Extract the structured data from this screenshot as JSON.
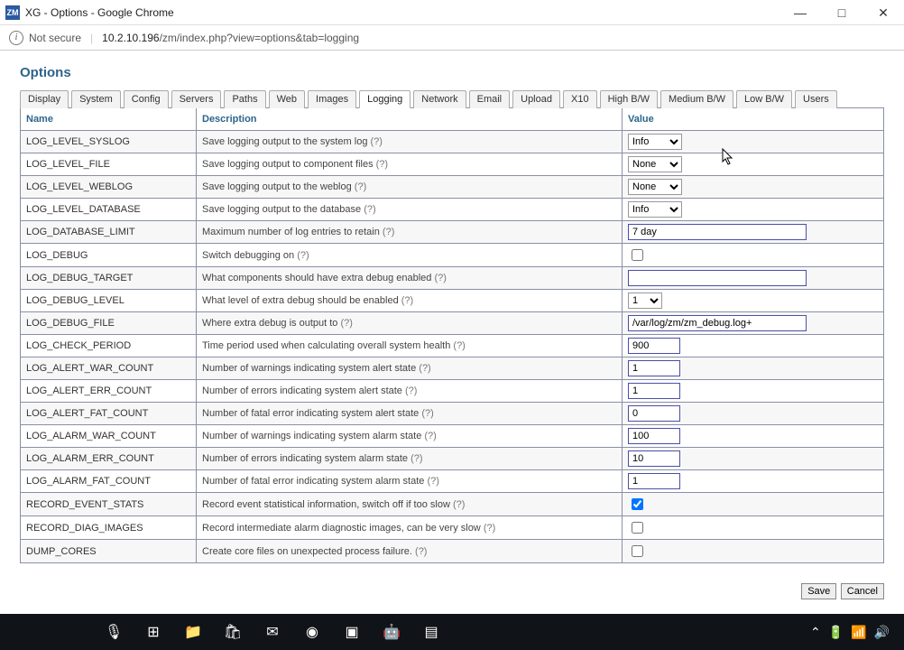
{
  "window": {
    "app_icon": "ZM",
    "title": "XG - Options - Google Chrome"
  },
  "address": {
    "insecure_label": "Not secure",
    "host": "10.2.10.196",
    "path": "/zm/index.php?view=options&tab=logging"
  },
  "page_title": "Options",
  "tabs": [
    {
      "label": "Display"
    },
    {
      "label": "System"
    },
    {
      "label": "Config"
    },
    {
      "label": "Servers"
    },
    {
      "label": "Paths"
    },
    {
      "label": "Web"
    },
    {
      "label": "Images"
    },
    {
      "label": "Logging",
      "active": true
    },
    {
      "label": "Network"
    },
    {
      "label": "Email"
    },
    {
      "label": "Upload"
    },
    {
      "label": "X10"
    },
    {
      "label": "High B/W"
    },
    {
      "label": "Medium B/W"
    },
    {
      "label": "Low B/W"
    },
    {
      "label": "Users"
    }
  ],
  "headers": {
    "name": "Name",
    "desc": "Description",
    "value": "Value"
  },
  "rows": [
    {
      "name": "LOG_LEVEL_SYSLOG",
      "desc": "Save logging output to the system log",
      "input": "select",
      "value": "Info"
    },
    {
      "name": "LOG_LEVEL_FILE",
      "desc": "Save logging output to component files",
      "input": "select",
      "value": "None"
    },
    {
      "name": "LOG_LEVEL_WEBLOG",
      "desc": "Save logging output to the weblog",
      "input": "select",
      "value": "None"
    },
    {
      "name": "LOG_LEVEL_DATABASE",
      "desc": "Save logging output to the database",
      "input": "select",
      "value": "Info"
    },
    {
      "name": "LOG_DATABASE_LIMIT",
      "desc": "Maximum number of log entries to retain",
      "input": "text",
      "value": "7 day",
      "wide": true
    },
    {
      "name": "LOG_DEBUG",
      "desc": "Switch debugging on",
      "input": "checkbox",
      "checked": false
    },
    {
      "name": "LOG_DEBUG_TARGET",
      "desc": "What components should have extra debug enabled",
      "input": "text",
      "value": "",
      "wide": true
    },
    {
      "name": "LOG_DEBUG_LEVEL",
      "desc": "What level of extra debug should be enabled",
      "input": "select",
      "value": "1",
      "narrow": true
    },
    {
      "name": "LOG_DEBUG_FILE",
      "desc": "Where extra debug is output to",
      "input": "text",
      "value": "/var/log/zm/zm_debug.log+",
      "wide": true
    },
    {
      "name": "LOG_CHECK_PERIOD",
      "desc": "Time period used when calculating overall system health",
      "input": "text",
      "value": "900"
    },
    {
      "name": "LOG_ALERT_WAR_COUNT",
      "desc": "Number of warnings indicating system alert state",
      "input": "text",
      "value": "1"
    },
    {
      "name": "LOG_ALERT_ERR_COUNT",
      "desc": "Number of errors indicating system alert state",
      "input": "text",
      "value": "1"
    },
    {
      "name": "LOG_ALERT_FAT_COUNT",
      "desc": "Number of fatal error indicating system alert state",
      "input": "text",
      "value": "0"
    },
    {
      "name": "LOG_ALARM_WAR_COUNT",
      "desc": "Number of warnings indicating system alarm state",
      "input": "text",
      "value": "100"
    },
    {
      "name": "LOG_ALARM_ERR_COUNT",
      "desc": "Number of errors indicating system alarm state",
      "input": "text",
      "value": "10"
    },
    {
      "name": "LOG_ALARM_FAT_COUNT",
      "desc": "Number of fatal error indicating system alarm state",
      "input": "text",
      "value": "1"
    },
    {
      "name": "RECORD_EVENT_STATS",
      "desc": "Record event statistical information, switch off if too slow",
      "input": "checkbox",
      "checked": true
    },
    {
      "name": "RECORD_DIAG_IMAGES",
      "desc": "Record intermediate alarm diagnostic images, can be very slow",
      "input": "checkbox",
      "checked": false
    },
    {
      "name": "DUMP_CORES",
      "desc": "Create core files on unexpected process failure.",
      "input": "checkbox",
      "checked": false
    }
  ],
  "help_marker": "(?)",
  "buttons": {
    "save": "Save",
    "cancel": "Cancel"
  },
  "taskbar": {
    "items": [
      {
        "name": "mic-icon",
        "glyph": "🎙"
      },
      {
        "name": "taskview-icon",
        "glyph": "⊞"
      },
      {
        "name": "explorer-icon",
        "glyph": "📁"
      },
      {
        "name": "store-icon",
        "glyph": "🛍"
      },
      {
        "name": "outlook-icon",
        "glyph": "✉"
      },
      {
        "name": "chrome-icon",
        "glyph": "◉"
      },
      {
        "name": "app1-icon",
        "glyph": "▣"
      },
      {
        "name": "android-icon",
        "glyph": "🤖"
      },
      {
        "name": "app2-icon",
        "glyph": "▤"
      }
    ],
    "tray": [
      {
        "name": "tray-overflow-icon",
        "glyph": "⌃"
      },
      {
        "name": "battery-icon",
        "glyph": "🔋"
      },
      {
        "name": "wifi-icon",
        "glyph": "📶"
      },
      {
        "name": "volume-icon",
        "glyph": "🔊"
      }
    ]
  }
}
